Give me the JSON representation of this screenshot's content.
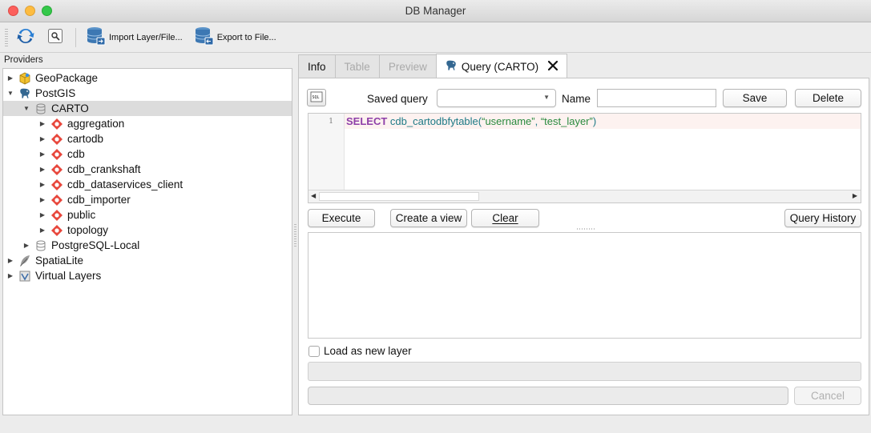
{
  "window": {
    "title": "DB Manager"
  },
  "toolbar": {
    "import_label": "Import Layer/File...",
    "export_label": "Export to File..."
  },
  "providers": {
    "label": "Providers",
    "items": [
      {
        "label": "GeoPackage",
        "icon": "geopackage-icon",
        "expanded": false
      },
      {
        "label": "PostGIS",
        "icon": "postgis-elephant-icon",
        "expanded": true
      },
      {
        "label": "CARTO",
        "icon": "database-icon",
        "expanded": true,
        "selected": true
      },
      {
        "label": "aggregation",
        "icon": "schema-icon"
      },
      {
        "label": "cartodb",
        "icon": "schema-icon"
      },
      {
        "label": "cdb",
        "icon": "schema-icon"
      },
      {
        "label": "cdb_crankshaft",
        "icon": "schema-icon"
      },
      {
        "label": "cdb_dataservices_client",
        "icon": "schema-icon"
      },
      {
        "label": "cdb_importer",
        "icon": "schema-icon"
      },
      {
        "label": "public",
        "icon": "schema-icon"
      },
      {
        "label": "topology",
        "icon": "schema-icon"
      },
      {
        "label": "PostgreSQL-Local",
        "icon": "database-icon",
        "expanded": false
      },
      {
        "label": "SpatiaLite",
        "icon": "feather-icon",
        "expanded": false
      },
      {
        "label": "Virtual Layers",
        "icon": "virtual-layers-icon",
        "expanded": false
      }
    ]
  },
  "tabs": [
    {
      "label": "Info",
      "enabled": true
    },
    {
      "label": "Table",
      "enabled": false
    },
    {
      "label": "Preview",
      "enabled": false
    },
    {
      "label": "Query (CARTO)",
      "active": true
    }
  ],
  "query": {
    "saved_query_label": "Saved query",
    "saved_query_value": "",
    "name_label": "Name",
    "name_value": "",
    "save_label": "Save",
    "delete_label": "Delete",
    "editor": {
      "line_number": "1",
      "keyword": "SELECT",
      "function": "cdb_cartodbfytable(",
      "arg1": "“username”",
      "comma": ", ",
      "arg2": "“test_layer”",
      "close": ")"
    },
    "execute_label": "Execute",
    "create_view_label": "Create a view",
    "clear_label": "Clear",
    "history_label": "Query History",
    "load_layer_label": "Load as new layer",
    "load_layer_checked": false,
    "cancel_label": "Cancel"
  }
}
